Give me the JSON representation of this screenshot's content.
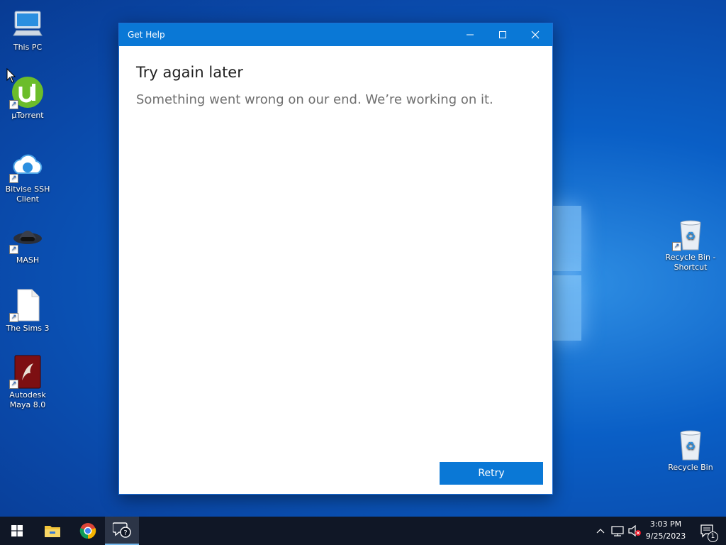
{
  "desktop": {
    "icons_left": [
      {
        "label": "This PC",
        "icon": "computer-icon"
      },
      {
        "label": "µTorrent",
        "icon": "utorrent-icon"
      },
      {
        "label": "Bitvise SSH Client",
        "icon": "bitvise-icon"
      },
      {
        "label": "MASH",
        "icon": "mash-icon"
      },
      {
        "label": "The Sims 3",
        "icon": "blank-file-icon"
      },
      {
        "label": "Autodesk Maya 8.0",
        "icon": "maya-icon"
      }
    ],
    "icons_right": [
      {
        "label": "Recycle Bin - Shortcut",
        "icon": "recycle-bin-icon"
      },
      {
        "label": "Recycle Bin",
        "icon": "recycle-bin-icon"
      }
    ]
  },
  "window": {
    "title": "Get Help",
    "heading": "Try again later",
    "message": "Something went wrong on our end. We’re working on it.",
    "retry_label": "Retry",
    "accent": "#0a78d6"
  },
  "taskbar": {
    "pinned": [
      "start-icon",
      "file-explorer-icon",
      "chrome-icon",
      "get-help-icon"
    ],
    "clock_time": "3:03 PM",
    "clock_date": "9/25/2023",
    "notification_count": "1"
  }
}
